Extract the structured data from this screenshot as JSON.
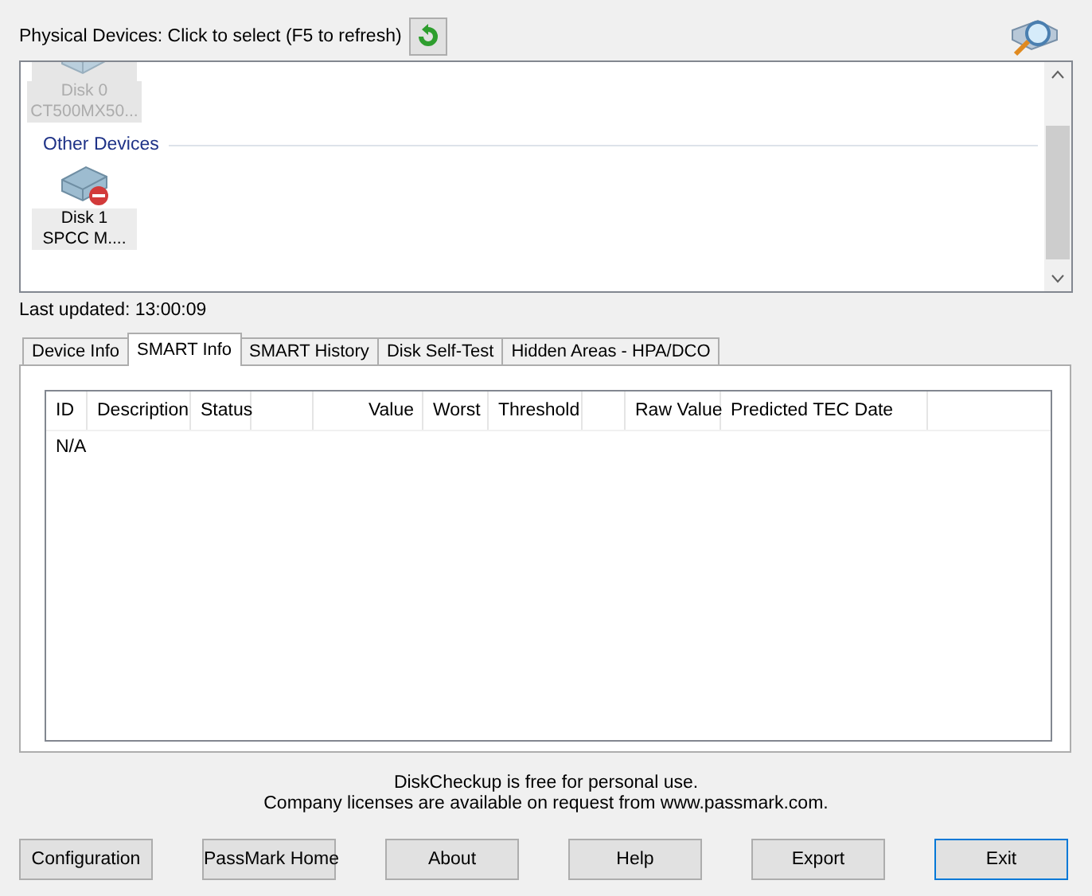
{
  "header": {
    "label": "Physical Devices: Click to select (F5 to refresh)"
  },
  "devices": [
    {
      "name": "Disk 0",
      "model": "CT500MX50...",
      "disabled": true
    }
  ],
  "other_devices": {
    "title": "Other Devices",
    "devices": [
      {
        "name": "Disk 1",
        "model": "SPCC M....",
        "disabled": false
      }
    ]
  },
  "last_updated": "Last updated: 13:00:09",
  "tabs": [
    {
      "label": "Device Info",
      "selected": false
    },
    {
      "label": "SMART Info",
      "selected": true
    },
    {
      "label": "SMART History",
      "selected": false
    },
    {
      "label": "Disk Self-Test",
      "selected": false
    },
    {
      "label": "Hidden Areas - HPA/DCO",
      "selected": false
    }
  ],
  "table": {
    "columns": [
      "ID",
      "Description",
      "Status",
      "Value",
      "Worst",
      "Threshold",
      "Raw Value",
      "Predicted TEC Date"
    ],
    "rows": [
      [
        "N/A"
      ]
    ]
  },
  "footer": [
    "DiskCheckup is free for personal use.",
    "Company licenses are available on request from www.passmark.com."
  ],
  "buttons": [
    {
      "label": "Configuration",
      "selected": false
    },
    {
      "label": "PassMark Home",
      "selected": false
    },
    {
      "label": "About",
      "selected": false
    },
    {
      "label": "Help",
      "selected": false
    },
    {
      "label": "Export",
      "selected": false
    },
    {
      "label": "Exit",
      "selected": true
    }
  ]
}
